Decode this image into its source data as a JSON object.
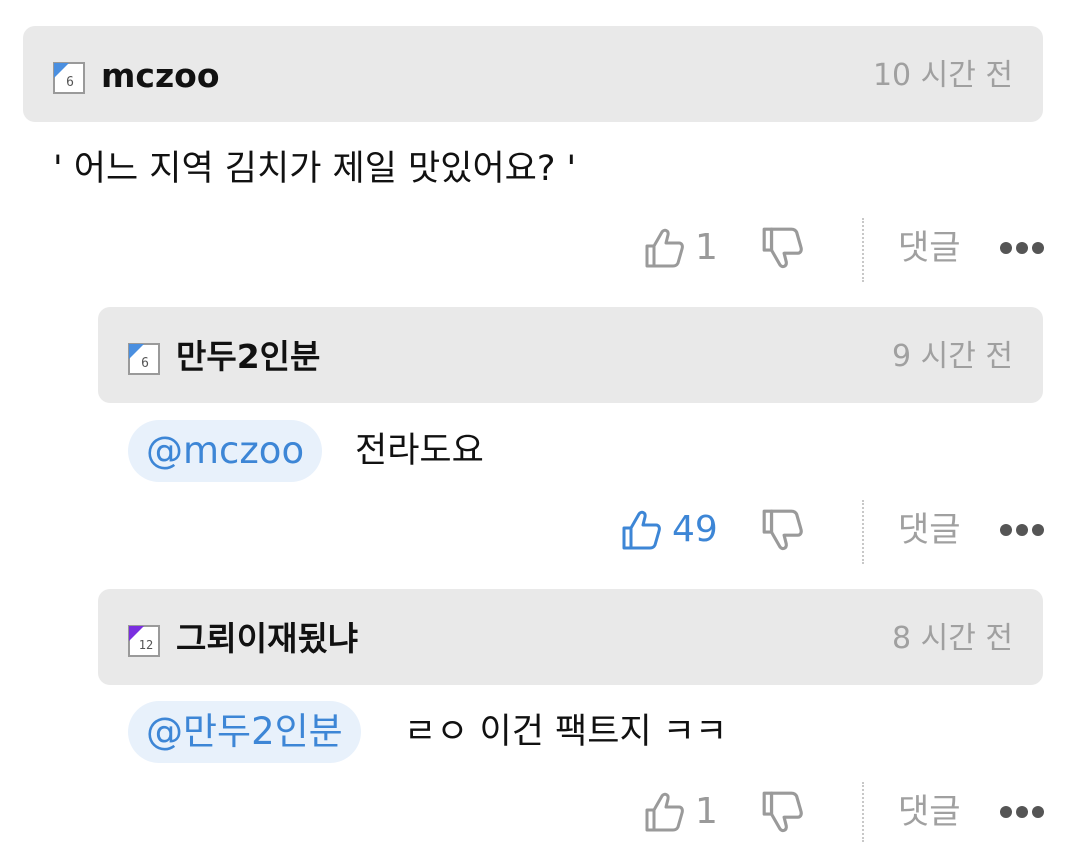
{
  "colors": {
    "header_bg": "#e9e9e9",
    "mention_bg": "#e8f1fb",
    "accent_blue": "#3d86d6",
    "muted_gray": "#a0a0a0",
    "badge_level6": "#4a8fe0",
    "badge_level12": "#7a2ee0"
  },
  "comments": [
    {
      "level_badge": "6",
      "username": "mczoo",
      "time": "10 시간 전",
      "text": "' 어느 지역 김치가 제일 맛있어요? '",
      "mention": "",
      "likes": "1",
      "liked": false,
      "reply_label": "댓글",
      "icons": {
        "like": "thumbs-up-icon",
        "dislike": "thumbs-down-icon",
        "more": "more-dots-icon"
      }
    },
    {
      "level_badge": "6",
      "username": "만두2인분",
      "time": "9 시간 전",
      "text": "전라도요",
      "mention": "@mczoo",
      "likes": "49",
      "liked": true,
      "reply_label": "댓글",
      "icons": {
        "like": "thumbs-up-icon",
        "dislike": "thumbs-down-icon",
        "more": "more-dots-icon"
      }
    },
    {
      "level_badge": "12",
      "username": "그뢰이재됬냐",
      "time": "8 시간 전",
      "text": "ㄹㅇ 이건 팩트지 ㅋㅋ",
      "mention": "@만두2인분",
      "likes": "1",
      "liked": false,
      "reply_label": "댓글",
      "icons": {
        "like": "thumbs-up-icon",
        "dislike": "thumbs-down-icon",
        "more": "more-dots-icon"
      }
    }
  ]
}
